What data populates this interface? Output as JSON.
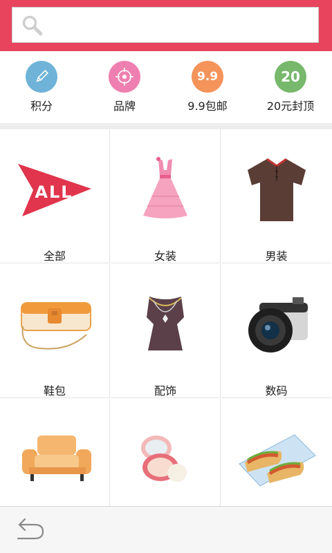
{
  "search": {
    "placeholder": "",
    "value": ""
  },
  "quick_links": [
    {
      "label": "积分",
      "icon": "pencil-icon",
      "color": "#6fb3d8"
    },
    {
      "label": "品牌",
      "icon": "target-icon",
      "color": "#ee7fb0"
    },
    {
      "label": "9.9包邮",
      "icon": "nine-nine-icon",
      "badge": "9.9",
      "color": "#f4945b"
    },
    {
      "label": "20元封顶",
      "icon": "twenty-icon",
      "badge": "20",
      "color": "#78b86c"
    }
  ],
  "categories": [
    {
      "label": "全部",
      "icon": "all-icon",
      "image_text": "ALL"
    },
    {
      "label": "女装",
      "icon": "dress-icon"
    },
    {
      "label": "男装",
      "icon": "polo-shirt-icon"
    },
    {
      "label": "鞋包",
      "icon": "handbag-icon"
    },
    {
      "label": "配饰",
      "icon": "necklace-icon"
    },
    {
      "label": "数码",
      "icon": "camera-icon"
    },
    {
      "label": "",
      "icon": "sofa-icon"
    },
    {
      "label": "",
      "icon": "compact-powder-icon"
    },
    {
      "label": "",
      "icon": "food-icon"
    }
  ],
  "colors": {
    "header": "#e8445e",
    "accent": "#e8445e"
  },
  "nav": {
    "back_icon": "back-arrow-icon"
  }
}
